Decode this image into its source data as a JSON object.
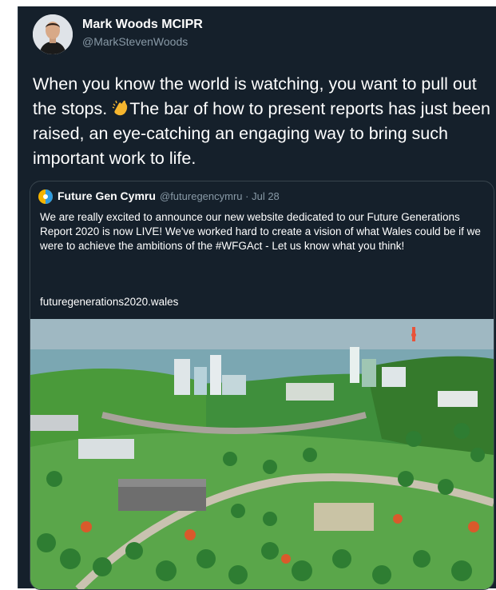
{
  "tweet": {
    "author_name": "Mark Woods MCIPR",
    "author_handle": "@MarkStevenWoods",
    "avatar_icon": "person-avatar",
    "text_before_emoji": "When you know the world is watching, you want to pull out the stops. ",
    "emoji": "clapping-hands-icon",
    "text_after_emoji": "The bar of how to present reports has just been raised, an eye-catching an engaging way to bring such important work to life."
  },
  "quoted_tweet": {
    "author_name": "Future Gen Cymru",
    "author_handle": "@futuregencymru",
    "date": "· Jul 28",
    "avatar_icon": "future-gen-logo",
    "text": "We are really excited to announce our new website dedicated to our Future Generations Report 2020 is now LIVE! We've worked hard to create a vision of what Wales could be if we were to achieve the ambitions of the #WFGAct - Let us know what you think!",
    "link": "futuregenerations2020.wales",
    "image_alt_icon": "isometric-town-illustration"
  },
  "colors": {
    "background": "#15202b",
    "border": "#38444d",
    "secondary_text": "#8899a6",
    "primary_text": "#ffffff"
  }
}
